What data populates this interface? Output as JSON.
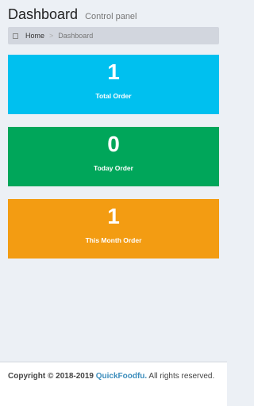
{
  "header": {
    "title": "Dashboard",
    "subtitle": "Control panel"
  },
  "breadcrumb": {
    "home": "Home",
    "separator": ">",
    "current": "Dashboard"
  },
  "stats": [
    {
      "value": "1",
      "label": "Total Order",
      "color": "#00c0ef"
    },
    {
      "value": "0",
      "label": "Today Order",
      "color": "#00a65a"
    },
    {
      "value": "1",
      "label": "This Month Order",
      "color": "#f39c12"
    }
  ],
  "footer": {
    "copyright": "Copyright © 2018-2019",
    "brand": "QuickFoodfu.",
    "rights": " All rights reserved."
  }
}
